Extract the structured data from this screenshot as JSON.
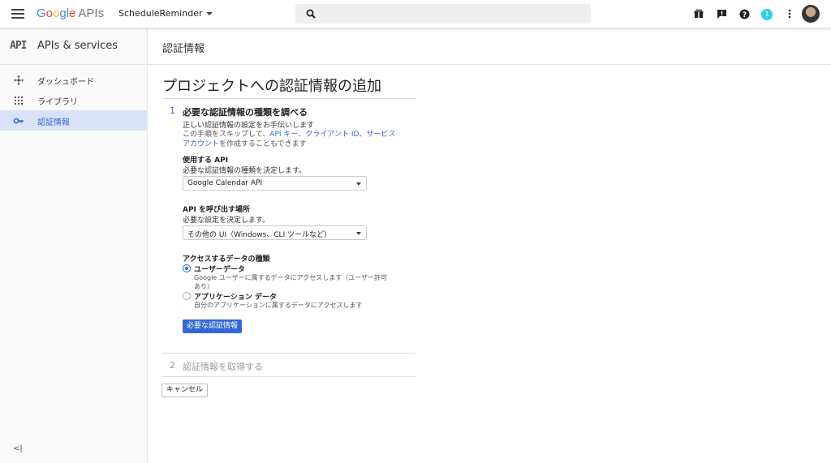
{
  "topbar": {
    "logo_parts": [
      "G",
      "o",
      "o",
      "g",
      "l",
      "e"
    ],
    "logo_suffix": "APIs",
    "project_name": "ScheduleReminder",
    "notification_count": "1",
    "icons": [
      "hamburger-icon",
      "search-icon",
      "gift-icon",
      "feedback-icon",
      "help-icon",
      "more-vert-icon",
      "avatar"
    ]
  },
  "sidebar": {
    "logo": "API",
    "title": "APIs & services",
    "items": [
      {
        "label": "ダッシュボード",
        "icon": "dashboard-icon"
      },
      {
        "label": "ライブラリ",
        "icon": "library-icon"
      },
      {
        "label": "認証情報",
        "icon": "key-icon",
        "active": true
      }
    ],
    "collapse": "<|"
  },
  "page": {
    "header_title": "認証情報",
    "heading": "プロジェクトへの認証情報の追加"
  },
  "step1": {
    "number": "1",
    "title": "必要な認証情報の種類を調べる",
    "desc_line1": "正しい認証情報の設定をお手伝いします",
    "desc_pre": "この手順をスキップして、",
    "link_api_key": "API キー",
    "sep1": "、",
    "link_client_id": "クライアント ID",
    "sep2": "、",
    "link_service_account": "サービス アカウント",
    "desc_post": "を作成することもできます",
    "api_label": "使用する API",
    "api_help": "必要な認証情報の種類を決定します。",
    "api_value": "Google Calendar API",
    "caller_label": "API を呼び出す場所",
    "caller_help": "必要な設定を決定します。",
    "caller_value": "その他の UI（Windows、CLI ツールなど）",
    "data_label": "アクセスするデータの種類",
    "radio_user": "ユーザーデータ",
    "radio_user_desc": "Google ユーザーに属するデータにアクセスします（ユーザー許可あり）",
    "radio_app": "アプリケーション データ",
    "radio_app_desc": "自分のアプリケーションに属するデータにアクセスします",
    "button": "必要な認証情報"
  },
  "step2": {
    "number": "2",
    "title": "認証情報を取得する"
  },
  "cancel": "キャンセル",
  "colors": {
    "accent": "#3367d6",
    "active_bg": "#d8e3f7",
    "badge": "#2ecde8"
  }
}
